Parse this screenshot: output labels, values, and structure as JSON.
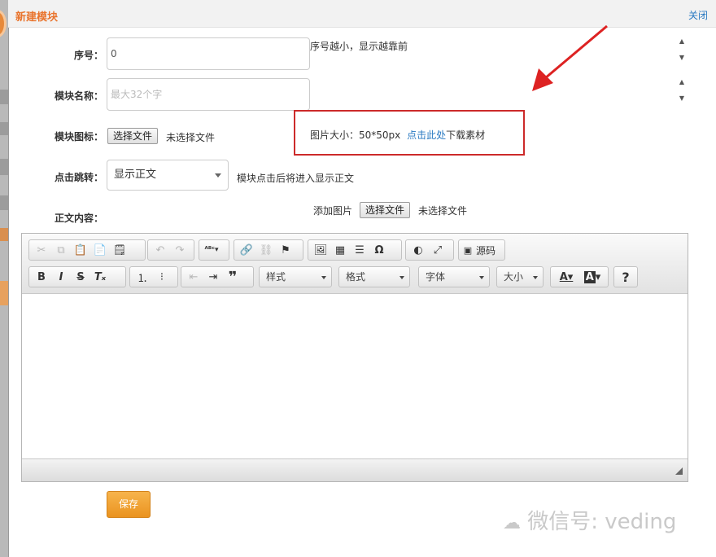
{
  "dialog": {
    "title": "新建模块",
    "close_label": "关闭"
  },
  "form": {
    "order": {
      "label": "序号：",
      "value": "0",
      "hint": "序号越小，显示越靠前"
    },
    "name": {
      "label": "模块名称：",
      "placeholder": "最大32个字"
    },
    "icon": {
      "label": "模块图标：",
      "button": "选择文件",
      "status": "未选择文件"
    },
    "size_note": {
      "text": "图片大小：50*50px",
      "link": "点击此处",
      "suffix": "下载素材"
    },
    "redirect": {
      "label": "点击跳转：",
      "selected": "显示正文",
      "hint": "模块点击后将进入显示正文"
    },
    "content": {
      "label": "正文内容：",
      "add_image": "添加图片",
      "button": "选择文件",
      "status": "未选择文件"
    }
  },
  "editor": {
    "source_label": "源码",
    "combos": {
      "style": "样式",
      "format": "格式",
      "font": "字体",
      "size": "大小"
    }
  },
  "save_label": "保存",
  "watermark": "微信号: veding",
  "colors": {
    "accent": "#e9742d",
    "link": "#2a7ac2",
    "save": "#ea9320",
    "highlight": "#cc2a2a"
  }
}
